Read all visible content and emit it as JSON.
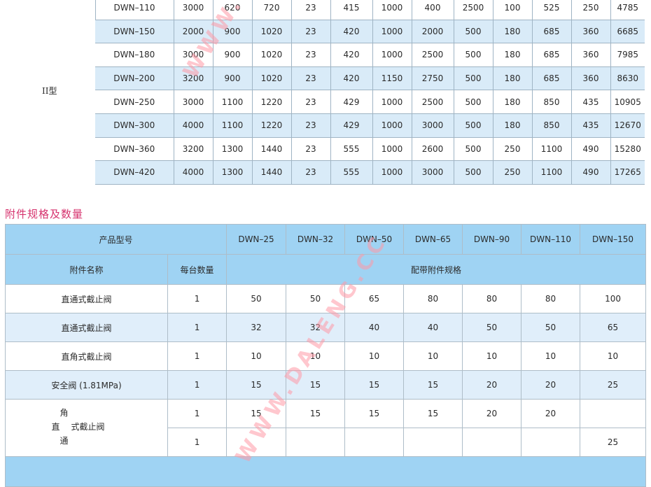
{
  "spec_table": {
    "group_label": "II型",
    "rows": [
      {
        "model": "DWN–110",
        "c": [
          "3000",
          "620",
          "720",
          "23",
          "415",
          "1000",
          "400",
          "2500",
          "100",
          "525",
          "250",
          "4785"
        ],
        "tint": false
      },
      {
        "model": "DWN–150",
        "c": [
          "2000",
          "900",
          "1020",
          "23",
          "420",
          "1000",
          "2000",
          "500",
          "180",
          "685",
          "360",
          "6685"
        ],
        "tint": true
      },
      {
        "model": "DWN–180",
        "c": [
          "3000",
          "900",
          "1020",
          "23",
          "420",
          "1000",
          "2500",
          "500",
          "180",
          "685",
          "360",
          "7985"
        ],
        "tint": false
      },
      {
        "model": "DWN–200",
        "c": [
          "3200",
          "900",
          "1020",
          "23",
          "420",
          "1150",
          "2750",
          "500",
          "180",
          "685",
          "360",
          "8630"
        ],
        "tint": true
      },
      {
        "model": "DWN–250",
        "c": [
          "3000",
          "1100",
          "1220",
          "23",
          "429",
          "1000",
          "2500",
          "500",
          "180",
          "850",
          "435",
          "10905"
        ],
        "tint": false
      },
      {
        "model": "DWN–300",
        "c": [
          "4000",
          "1100",
          "1220",
          "23",
          "429",
          "1000",
          "3000",
          "500",
          "180",
          "850",
          "435",
          "12670"
        ],
        "tint": true
      },
      {
        "model": "DWN–360",
        "c": [
          "3200",
          "1300",
          "1440",
          "23",
          "555",
          "1000",
          "2600",
          "500",
          "250",
          "1100",
          "490",
          "15280"
        ],
        "tint": false
      },
      {
        "model": "DWN–420",
        "c": [
          "4000",
          "1300",
          "1440",
          "23",
          "555",
          "1000",
          "3000",
          "500",
          "250",
          "1100",
          "490",
          "17265"
        ],
        "tint": true
      }
    ]
  },
  "section_title": "附件规格及数量",
  "accessory_table": {
    "product_model_label": "产品型号",
    "models": [
      "DWN–25",
      "DWN–32",
      "DWN–50",
      "DWN–65",
      "DWN–90",
      "DWN–110",
      "DWN–150"
    ],
    "name_header": "附件名称",
    "qty_header": "每台数量",
    "spec_header": "配带附件规格",
    "rows": [
      {
        "name": "直通式截止阀",
        "qty": "1",
        "v": [
          "50",
          "50",
          "65",
          "80",
          "80",
          "80",
          "100"
        ],
        "blue": false
      },
      {
        "name": "直通式截止阀",
        "qty": "1",
        "v": [
          "32",
          "32",
          "40",
          "40",
          "50",
          "50",
          "65"
        ],
        "blue": true
      },
      {
        "name": "直角式截止阀",
        "qty": "1",
        "v": [
          "10",
          "10",
          "10",
          "10",
          "10",
          "10",
          "10"
        ],
        "blue": false
      },
      {
        "name": "安全阀 (1.81MPa)",
        "qty": "1",
        "v": [
          "15",
          "15",
          "15",
          "15",
          "20",
          "20",
          "25"
        ],
        "blue": true
      }
    ],
    "angle_block": {
      "label_top": "角",
      "label_mid": "直",
      "label_bottom": "通",
      "label_suffix": "式截止阀",
      "row1_qty": "1",
      "row1": [
        "15",
        "15",
        "15",
        "15",
        "20",
        "20",
        ""
      ],
      "row2_qty": "1",
      "row2": [
        "",
        "",
        "",
        "",
        "",
        "",
        "25"
      ]
    }
  },
  "watermark": {
    "text_top": "WWW.DA",
    "text_bottom": "WWW.DALENG.CC"
  }
}
